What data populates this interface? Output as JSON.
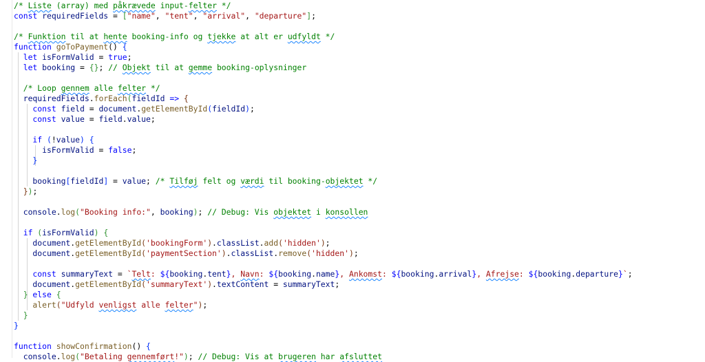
{
  "colors": {
    "comment": "#008000",
    "keyword": "#0000ff",
    "string": "#a31515",
    "variable": "#001080",
    "function": "#795e26",
    "spellcheck_underline": "#1a85ff"
  },
  "code_lines": [
    [
      {
        "t": "/* ",
        "c": "c"
      },
      {
        "t": "Liste",
        "c": "c",
        "u": 1
      },
      {
        "t": " (array) med ",
        "c": "c"
      },
      {
        "t": "påkrævede",
        "c": "c",
        "u": 1
      },
      {
        "t": " input-",
        "c": "c"
      },
      {
        "t": "felter",
        "c": "c",
        "u": 1
      },
      {
        "t": " */",
        "c": "c"
      }
    ],
    [
      {
        "t": "const ",
        "c": "k"
      },
      {
        "t": "requiredFields",
        "c": "v"
      },
      {
        "t": " = ",
        "c": "p"
      },
      {
        "t": "[",
        "c": "b2"
      },
      {
        "t": "\"name\"",
        "c": "s"
      },
      {
        "t": ", ",
        "c": "p"
      },
      {
        "t": "\"tent\"",
        "c": "s"
      },
      {
        "t": ", ",
        "c": "p"
      },
      {
        "t": "\"arrival\"",
        "c": "s"
      },
      {
        "t": ", ",
        "c": "p"
      },
      {
        "t": "\"departure\"",
        "c": "s"
      },
      {
        "t": "]",
        "c": "b2"
      },
      {
        "t": ";",
        "c": "p"
      }
    ],
    [],
    [
      {
        "t": "/* ",
        "c": "c"
      },
      {
        "t": "Funktion",
        "c": "c",
        "u": 1
      },
      {
        "t": " til at ",
        "c": "c"
      },
      {
        "t": "hente",
        "c": "c",
        "u": 1
      },
      {
        "t": " booking-info og ",
        "c": "c"
      },
      {
        "t": "tjekke",
        "c": "c",
        "u": 1
      },
      {
        "t": " at alt er ",
        "c": "c"
      },
      {
        "t": "udfyldt",
        "c": "c",
        "u": 1
      },
      {
        "t": " */",
        "c": "c"
      }
    ],
    [
      {
        "t": "function ",
        "c": "k"
      },
      {
        "t": "goToPayment",
        "c": "f"
      },
      {
        "t": "() ",
        "c": "p"
      },
      {
        "t": "{",
        "c": "b1"
      }
    ],
    [
      {
        "t": "  let ",
        "c": "k"
      },
      {
        "t": "isFormValid",
        "c": "v"
      },
      {
        "t": " = ",
        "c": "p"
      },
      {
        "t": "true",
        "c": "k"
      },
      {
        "t": ";",
        "c": "p"
      }
    ],
    [
      {
        "t": "  let ",
        "c": "k"
      },
      {
        "t": "booking",
        "c": "v"
      },
      {
        "t": " = ",
        "c": "p"
      },
      {
        "t": "{}",
        "c": "b2"
      },
      {
        "t": "; ",
        "c": "p"
      },
      {
        "t": "// ",
        "c": "c"
      },
      {
        "t": "Objekt",
        "c": "c",
        "u": 1
      },
      {
        "t": " til at ",
        "c": "c"
      },
      {
        "t": "gemme",
        "c": "c",
        "u": 1
      },
      {
        "t": " booking-oplysninger",
        "c": "c"
      }
    ],
    [],
    [
      {
        "t": "  /* Loop ",
        "c": "c"
      },
      {
        "t": "gennem",
        "c": "c",
        "u": 1
      },
      {
        "t": " alle ",
        "c": "c"
      },
      {
        "t": "felter",
        "c": "c",
        "u": 1
      },
      {
        "t": " */",
        "c": "c"
      }
    ],
    [
      {
        "t": "  requiredFields",
        "c": "v"
      },
      {
        "t": ".",
        "c": "p"
      },
      {
        "t": "forEach",
        "c": "f"
      },
      {
        "t": "(",
        "c": "b2"
      },
      {
        "t": "fieldId",
        "c": "v"
      },
      {
        "t": " => ",
        "c": "k"
      },
      {
        "t": "{",
        "c": "b3"
      }
    ],
    [
      {
        "t": "    const ",
        "c": "k"
      },
      {
        "t": "field",
        "c": "v"
      },
      {
        "t": " = ",
        "c": "p"
      },
      {
        "t": "document",
        "c": "v"
      },
      {
        "t": ".",
        "c": "p"
      },
      {
        "t": "getElementById",
        "c": "f"
      },
      {
        "t": "(",
        "c": "b1"
      },
      {
        "t": "fieldId",
        "c": "v"
      },
      {
        "t": ")",
        "c": "b1"
      },
      {
        "t": ";",
        "c": "p"
      }
    ],
    [
      {
        "t": "    const ",
        "c": "k"
      },
      {
        "t": "value",
        "c": "v"
      },
      {
        "t": " = ",
        "c": "p"
      },
      {
        "t": "field",
        "c": "v"
      },
      {
        "t": ".",
        "c": "p"
      },
      {
        "t": "value",
        "c": "v"
      },
      {
        "t": ";",
        "c": "p"
      }
    ],
    [],
    [
      {
        "t": "    if ",
        "c": "k"
      },
      {
        "t": "(",
        "c": "b1"
      },
      {
        "t": "!",
        "c": "p"
      },
      {
        "t": "value",
        "c": "v"
      },
      {
        "t": ")",
        "c": "b1"
      },
      {
        "t": " ",
        "c": "p"
      },
      {
        "t": "{",
        "c": "b1"
      }
    ],
    [
      {
        "t": "      isFormValid",
        "c": "v"
      },
      {
        "t": " = ",
        "c": "p"
      },
      {
        "t": "false",
        "c": "k"
      },
      {
        "t": ";",
        "c": "p"
      }
    ],
    [
      {
        "t": "    }",
        "c": "b1"
      }
    ],
    [],
    [
      {
        "t": "    booking",
        "c": "v"
      },
      {
        "t": "[",
        "c": "b1"
      },
      {
        "t": "fieldId",
        "c": "v"
      },
      {
        "t": "]",
        "c": "b1"
      },
      {
        "t": " = ",
        "c": "p"
      },
      {
        "t": "value",
        "c": "v"
      },
      {
        "t": "; ",
        "c": "p"
      },
      {
        "t": "/* ",
        "c": "c"
      },
      {
        "t": "Tilføj",
        "c": "c",
        "u": 1
      },
      {
        "t": " felt og ",
        "c": "c"
      },
      {
        "t": "værdi",
        "c": "c",
        "u": 1
      },
      {
        "t": " til booking-",
        "c": "c"
      },
      {
        "t": "objektet",
        "c": "c",
        "u": 1
      },
      {
        "t": " */",
        "c": "c"
      }
    ],
    [
      {
        "t": "  }",
        "c": "b3"
      },
      {
        "t": ")",
        "c": "b2"
      },
      {
        "t": ";",
        "c": "p"
      }
    ],
    [],
    [
      {
        "t": "  console",
        "c": "v"
      },
      {
        "t": ".",
        "c": "p"
      },
      {
        "t": "log",
        "c": "f"
      },
      {
        "t": "(",
        "c": "b2"
      },
      {
        "t": "\"Booking info:\"",
        "c": "s"
      },
      {
        "t": ", ",
        "c": "p"
      },
      {
        "t": "booking",
        "c": "v"
      },
      {
        "t": ")",
        "c": "b2"
      },
      {
        "t": "; ",
        "c": "p"
      },
      {
        "t": "// Debug: Vis ",
        "c": "c"
      },
      {
        "t": "objektet",
        "c": "c",
        "u": 1
      },
      {
        "t": " i ",
        "c": "c"
      },
      {
        "t": "konsollen",
        "c": "c",
        "u": 1
      }
    ],
    [],
    [
      {
        "t": "  if ",
        "c": "k"
      },
      {
        "t": "(",
        "c": "b2"
      },
      {
        "t": "isFormValid",
        "c": "v"
      },
      {
        "t": ")",
        "c": "b2"
      },
      {
        "t": " ",
        "c": "p"
      },
      {
        "t": "{",
        "c": "b2"
      }
    ],
    [
      {
        "t": "    document",
        "c": "v"
      },
      {
        "t": ".",
        "c": "p"
      },
      {
        "t": "getElementById",
        "c": "f"
      },
      {
        "t": "(",
        "c": "b3"
      },
      {
        "t": "'bookingForm'",
        "c": "s"
      },
      {
        "t": ")",
        "c": "b3"
      },
      {
        "t": ".",
        "c": "p"
      },
      {
        "t": "classList",
        "c": "v"
      },
      {
        "t": ".",
        "c": "p"
      },
      {
        "t": "add",
        "c": "f"
      },
      {
        "t": "(",
        "c": "b3"
      },
      {
        "t": "'hidden'",
        "c": "s"
      },
      {
        "t": ")",
        "c": "b3"
      },
      {
        "t": ";",
        "c": "p"
      }
    ],
    [
      {
        "t": "    document",
        "c": "v"
      },
      {
        "t": ".",
        "c": "p"
      },
      {
        "t": "getElementById",
        "c": "f"
      },
      {
        "t": "(",
        "c": "b3"
      },
      {
        "t": "'paymentSection'",
        "c": "s"
      },
      {
        "t": ")",
        "c": "b3"
      },
      {
        "t": ".",
        "c": "p"
      },
      {
        "t": "classList",
        "c": "v"
      },
      {
        "t": ".",
        "c": "p"
      },
      {
        "t": "remove",
        "c": "f"
      },
      {
        "t": "(",
        "c": "b3"
      },
      {
        "t": "'hidden'",
        "c": "s"
      },
      {
        "t": ")",
        "c": "b3"
      },
      {
        "t": ";",
        "c": "p"
      }
    ],
    [],
    [
      {
        "t": "    const ",
        "c": "k"
      },
      {
        "t": "summaryText",
        "c": "v"
      },
      {
        "t": " = ",
        "c": "p"
      },
      {
        "t": "`",
        "c": "t"
      },
      {
        "t": "Telt",
        "c": "t",
        "u": 1
      },
      {
        "t": ": ",
        "c": "t"
      },
      {
        "t": "${",
        "c": "k"
      },
      {
        "t": "booking",
        "c": "v"
      },
      {
        "t": ".",
        "c": "p"
      },
      {
        "t": "tent",
        "c": "v"
      },
      {
        "t": "}",
        "c": "k"
      },
      {
        "t": ", ",
        "c": "t"
      },
      {
        "t": "Navn",
        "c": "t",
        "u": 1
      },
      {
        "t": ": ",
        "c": "t"
      },
      {
        "t": "${",
        "c": "k"
      },
      {
        "t": "booking",
        "c": "v"
      },
      {
        "t": ".",
        "c": "p"
      },
      {
        "t": "name",
        "c": "v"
      },
      {
        "t": "}",
        "c": "k"
      },
      {
        "t": ", ",
        "c": "t"
      },
      {
        "t": "Ankomst",
        "c": "t",
        "u": 1
      },
      {
        "t": ": ",
        "c": "t"
      },
      {
        "t": "${",
        "c": "k"
      },
      {
        "t": "booking",
        "c": "v"
      },
      {
        "t": ".",
        "c": "p"
      },
      {
        "t": "arrival",
        "c": "v"
      },
      {
        "t": "}",
        "c": "k"
      },
      {
        "t": ", ",
        "c": "t"
      },
      {
        "t": "Afrejse",
        "c": "t",
        "u": 1
      },
      {
        "t": ": ",
        "c": "t"
      },
      {
        "t": "${",
        "c": "k"
      },
      {
        "t": "booking",
        "c": "v"
      },
      {
        "t": ".",
        "c": "p"
      },
      {
        "t": "departure",
        "c": "v"
      },
      {
        "t": "}",
        "c": "k"
      },
      {
        "t": "`",
        "c": "t"
      },
      {
        "t": ";",
        "c": "p"
      }
    ],
    [
      {
        "t": "    document",
        "c": "v"
      },
      {
        "t": ".",
        "c": "p"
      },
      {
        "t": "getElementById",
        "c": "f"
      },
      {
        "t": "(",
        "c": "b3"
      },
      {
        "t": "'summaryText'",
        "c": "s"
      },
      {
        "t": ")",
        "c": "b3"
      },
      {
        "t": ".",
        "c": "p"
      },
      {
        "t": "textContent",
        "c": "v"
      },
      {
        "t": " = ",
        "c": "p"
      },
      {
        "t": "summaryText",
        "c": "v"
      },
      {
        "t": ";",
        "c": "p"
      }
    ],
    [
      {
        "t": "  }",
        "c": "b2"
      },
      {
        "t": " else ",
        "c": "k"
      },
      {
        "t": "{",
        "c": "b2"
      }
    ],
    [
      {
        "t": "    alert",
        "c": "f"
      },
      {
        "t": "(",
        "c": "b3"
      },
      {
        "t": "\"Udfyld ",
        "c": "s"
      },
      {
        "t": "venligst",
        "c": "s",
        "u": 1
      },
      {
        "t": " alle ",
        "c": "s"
      },
      {
        "t": "felter",
        "c": "s",
        "u": 1
      },
      {
        "t": "\"",
        "c": "s"
      },
      {
        "t": ")",
        "c": "b3"
      },
      {
        "t": ";",
        "c": "p"
      }
    ],
    [
      {
        "t": "  }",
        "c": "b2"
      }
    ],
    [
      {
        "t": "}",
        "c": "b1"
      }
    ],
    [],
    [
      {
        "t": "function ",
        "c": "k"
      },
      {
        "t": "showConfirmation",
        "c": "f"
      },
      {
        "t": "() ",
        "c": "p"
      },
      {
        "t": "{",
        "c": "b1"
      }
    ],
    [
      {
        "t": "  console",
        "c": "v"
      },
      {
        "t": ".",
        "c": "p"
      },
      {
        "t": "log",
        "c": "f"
      },
      {
        "t": "(",
        "c": "b2"
      },
      {
        "t": "\"Betaling ",
        "c": "s"
      },
      {
        "t": "gennemført",
        "c": "s",
        "u": 1
      },
      {
        "t": "!\"",
        "c": "s"
      },
      {
        "t": ")",
        "c": "b2"
      },
      {
        "t": "; ",
        "c": "p"
      },
      {
        "t": "// Debug: Vis at ",
        "c": "c"
      },
      {
        "t": "brugeren",
        "c": "c",
        "u": 1
      },
      {
        "t": " har ",
        "c": "c"
      },
      {
        "t": "afsluttet",
        "c": "c",
        "u": 1
      }
    ]
  ]
}
